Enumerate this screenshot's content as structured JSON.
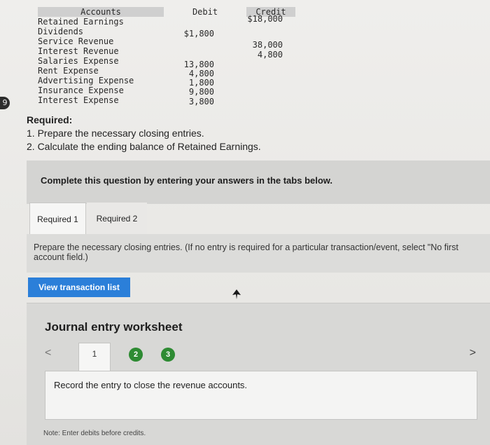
{
  "side_number": "9",
  "trial_balance": {
    "headers": {
      "account": "Accounts",
      "debit": "Debit",
      "credit": "Credit"
    },
    "rows": [
      {
        "name": "Retained Earnings",
        "debit": "",
        "credit": "$18,000"
      },
      {
        "name": "Dividends",
        "debit": "$1,800",
        "credit": ""
      },
      {
        "name": "Service Revenue",
        "debit": "",
        "credit": "38,000"
      },
      {
        "name": "Interest Revenue",
        "debit": "",
        "credit": "4,800"
      },
      {
        "name": "Salaries Expense",
        "debit": "13,800",
        "credit": ""
      },
      {
        "name": "Rent Expense",
        "debit": "4,800",
        "credit": ""
      },
      {
        "name": "Advertising Expense",
        "debit": "1,800",
        "credit": ""
      },
      {
        "name": "Insurance Expense",
        "debit": "9,800",
        "credit": ""
      },
      {
        "name": "Interest Expense",
        "debit": "3,800",
        "credit": ""
      }
    ]
  },
  "required": {
    "title": "Required:",
    "items": [
      "1. Prepare the necessary closing entries.",
      "2. Calculate the ending balance of Retained Earnings."
    ]
  },
  "banner": "Complete this question by entering your answers in the tabs below.",
  "tabs": [
    {
      "label": "Required 1"
    },
    {
      "label": "Required 2"
    }
  ],
  "instructions": "Prepare the necessary closing entries. (If no entry is required for a particular transaction/event, select \"No first account field.)",
  "view_button": "View transaction list",
  "worksheet": {
    "title": "Journal entry worksheet",
    "prev": "<",
    "next": ">",
    "pages": [
      "1",
      "2",
      "3"
    ],
    "entry_text": "Record the entry to close the revenue accounts.",
    "note": "Note: Enter debits before credits."
  },
  "colors": {
    "accent": "#2b7fd9",
    "complete": "#2e8b33"
  }
}
